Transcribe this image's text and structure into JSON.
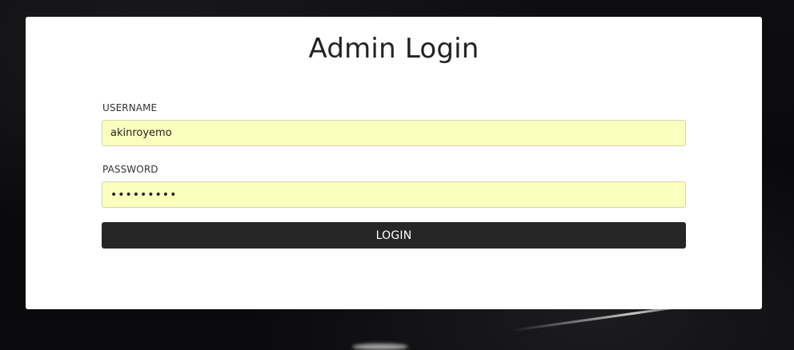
{
  "page": {
    "title": "Admin Login"
  },
  "form": {
    "username": {
      "label": "USERNAME",
      "value": "akinroyemo"
    },
    "password": {
      "label": "PASSWORD",
      "value": "akinroyem"
    },
    "submit_label": "LOGIN"
  },
  "colors": {
    "autofill_background": "#faffbd",
    "button_background": "#262626",
    "page_background": "#0b0b0d",
    "card_background": "#ffffff"
  }
}
